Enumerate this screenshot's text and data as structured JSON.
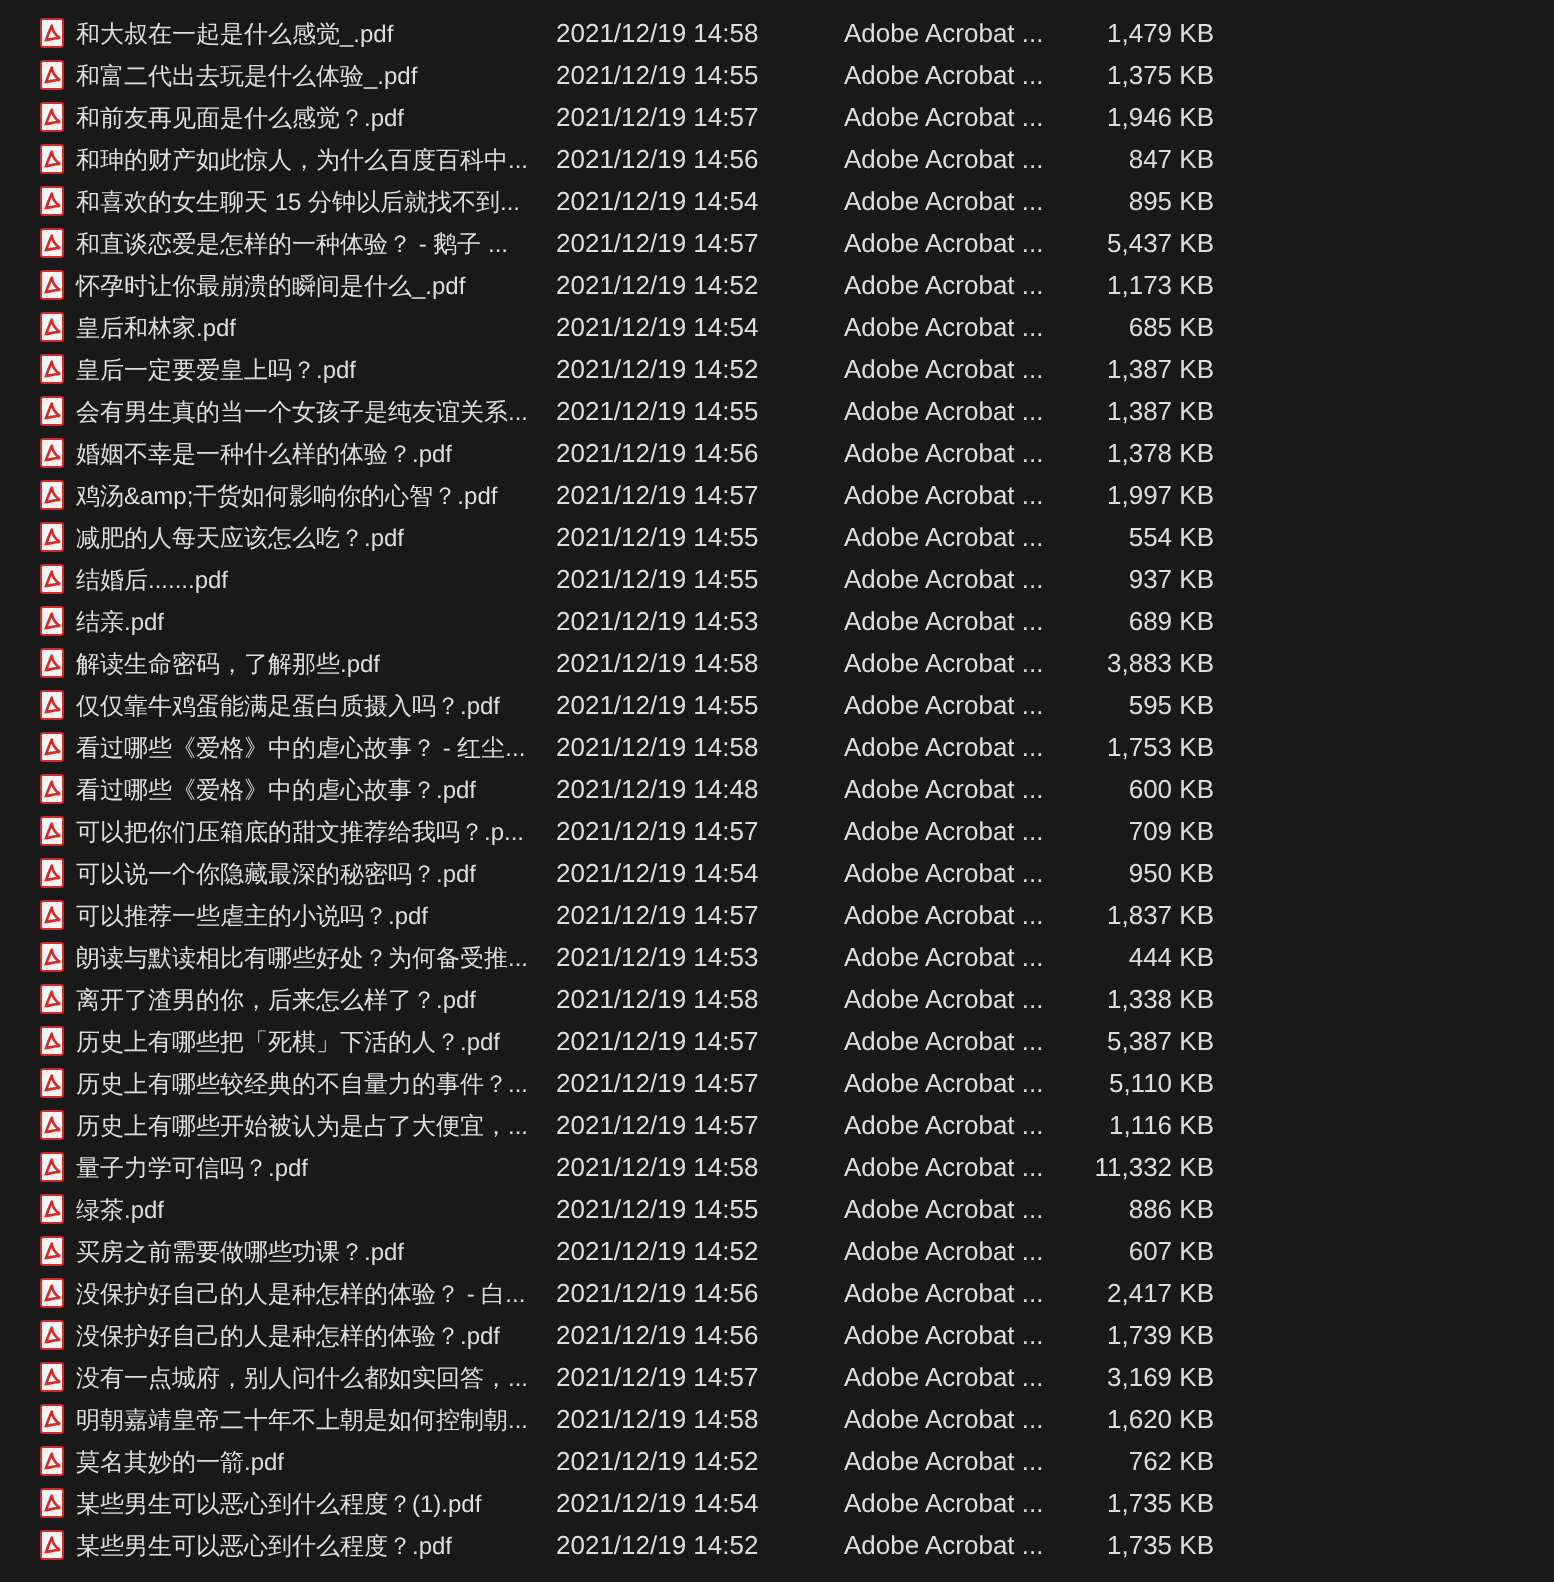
{
  "files": [
    {
      "name": "和大叔在一起是什么感觉_.pdf",
      "modified": "2021/12/19 14:58",
      "type": "Adobe Acrobat ...",
      "size": "1,479 KB"
    },
    {
      "name": "和富二代出去玩是什么体验_.pdf",
      "modified": "2021/12/19 14:55",
      "type": "Adobe Acrobat ...",
      "size": "1,375 KB"
    },
    {
      "name": "和前友再见面是什么感觉？.pdf",
      "modified": "2021/12/19 14:57",
      "type": "Adobe Acrobat ...",
      "size": "1,946 KB"
    },
    {
      "name": "和珅的财产如此惊人，为什么百度百科中...",
      "modified": "2021/12/19 14:56",
      "type": "Adobe Acrobat ...",
      "size": "847 KB"
    },
    {
      "name": "和喜欢的女生聊天 15 分钟以后就找不到...",
      "modified": "2021/12/19 14:54",
      "type": "Adobe Acrobat ...",
      "size": "895 KB"
    },
    {
      "name": "和直谈恋爱是怎样的一种体验？ - 鹅子 ...",
      "modified": "2021/12/19 14:57",
      "type": "Adobe Acrobat ...",
      "size": "5,437 KB"
    },
    {
      "name": "怀孕时让你最崩溃的瞬间是什么_.pdf",
      "modified": "2021/12/19 14:52",
      "type": "Adobe Acrobat ...",
      "size": "1,173 KB"
    },
    {
      "name": "皇后和林家.pdf",
      "modified": "2021/12/19 14:54",
      "type": "Adobe Acrobat ...",
      "size": "685 KB"
    },
    {
      "name": "皇后一定要爱皇上吗？.pdf",
      "modified": "2021/12/19 14:52",
      "type": "Adobe Acrobat ...",
      "size": "1,387 KB"
    },
    {
      "name": "会有男生真的当一个女孩子是纯友谊关系...",
      "modified": "2021/12/19 14:55",
      "type": "Adobe Acrobat ...",
      "size": "1,387 KB"
    },
    {
      "name": "婚姻不幸是一种什么样的体验？.pdf",
      "modified": "2021/12/19 14:56",
      "type": "Adobe Acrobat ...",
      "size": "1,378 KB"
    },
    {
      "name": "鸡汤&amp;干货如何影响你的心智？.pdf",
      "modified": "2021/12/19 14:57",
      "type": "Adobe Acrobat ...",
      "size": "1,997 KB"
    },
    {
      "name": "减肥的人每天应该怎么吃？.pdf",
      "modified": "2021/12/19 14:55",
      "type": "Adobe Acrobat ...",
      "size": "554 KB"
    },
    {
      "name": "结婚后.......pdf",
      "modified": "2021/12/19 14:55",
      "type": "Adobe Acrobat ...",
      "size": "937 KB"
    },
    {
      "name": "结亲.pdf",
      "modified": "2021/12/19 14:53",
      "type": "Adobe Acrobat ...",
      "size": "689 KB"
    },
    {
      "name": "解读生命密码，了解那些.pdf",
      "modified": "2021/12/19 14:58",
      "type": "Adobe Acrobat ...",
      "size": "3,883 KB"
    },
    {
      "name": "仅仅靠牛鸡蛋能满足蛋白质摄入吗？.pdf",
      "modified": "2021/12/19 14:55",
      "type": "Adobe Acrobat ...",
      "size": "595 KB"
    },
    {
      "name": "看过哪些《爱格》中的虐心故事？ - 红尘...",
      "modified": "2021/12/19 14:58",
      "type": "Adobe Acrobat ...",
      "size": "1,753 KB"
    },
    {
      "name": "看过哪些《爱格》中的虐心故事？.pdf",
      "modified": "2021/12/19 14:48",
      "type": "Adobe Acrobat ...",
      "size": "600 KB"
    },
    {
      "name": "可以把你们压箱底的甜文推荐给我吗？.p...",
      "modified": "2021/12/19 14:57",
      "type": "Adobe Acrobat ...",
      "size": "709 KB"
    },
    {
      "name": "可以说一个你隐藏最深的秘密吗？.pdf",
      "modified": "2021/12/19 14:54",
      "type": "Adobe Acrobat ...",
      "size": "950 KB"
    },
    {
      "name": "可以推荐一些虐主的小说吗？.pdf",
      "modified": "2021/12/19 14:57",
      "type": "Adobe Acrobat ...",
      "size": "1,837 KB"
    },
    {
      "name": "朗读与默读相比有哪些好处？为何备受推...",
      "modified": "2021/12/19 14:53",
      "type": "Adobe Acrobat ...",
      "size": "444 KB"
    },
    {
      "name": "离开了渣男的你，后来怎么样了？.pdf",
      "modified": "2021/12/19 14:58",
      "type": "Adobe Acrobat ...",
      "size": "1,338 KB"
    },
    {
      "name": "历史上有哪些把「死棋」下活的人？.pdf",
      "modified": "2021/12/19 14:57",
      "type": "Adobe Acrobat ...",
      "size": "5,387 KB"
    },
    {
      "name": "历史上有哪些较经典的不自量力的事件？...",
      "modified": "2021/12/19 14:57",
      "type": "Adobe Acrobat ...",
      "size": "5,110 KB"
    },
    {
      "name": "历史上有哪些开始被认为是占了大便宜，...",
      "modified": "2021/12/19 14:57",
      "type": "Adobe Acrobat ...",
      "size": "1,116 KB"
    },
    {
      "name": "量子力学可信吗？.pdf",
      "modified": "2021/12/19 14:58",
      "type": "Adobe Acrobat ...",
      "size": "11,332 KB"
    },
    {
      "name": "绿茶.pdf",
      "modified": "2021/12/19 14:55",
      "type": "Adobe Acrobat ...",
      "size": "886 KB"
    },
    {
      "name": "买房之前需要做哪些功课？.pdf",
      "modified": "2021/12/19 14:52",
      "type": "Adobe Acrobat ...",
      "size": "607 KB"
    },
    {
      "name": "没保护好自己的人是种怎样的体验？ - 白...",
      "modified": "2021/12/19 14:56",
      "type": "Adobe Acrobat ...",
      "size": "2,417 KB"
    },
    {
      "name": "没保护好自己的人是种怎样的体验？.pdf",
      "modified": "2021/12/19 14:56",
      "type": "Adobe Acrobat ...",
      "size": "1,739 KB"
    },
    {
      "name": "没有一点城府，别人问什么都如实回答，...",
      "modified": "2021/12/19 14:57",
      "type": "Adobe Acrobat ...",
      "size": "3,169 KB"
    },
    {
      "name": "明朝嘉靖皇帝二十年不上朝是如何控制朝...",
      "modified": "2021/12/19 14:58",
      "type": "Adobe Acrobat ...",
      "size": "1,620 KB"
    },
    {
      "name": "莫名其妙的一箭.pdf",
      "modified": "2021/12/19 14:52",
      "type": "Adobe Acrobat ...",
      "size": "762 KB"
    },
    {
      "name": "某些男生可以恶心到什么程度？(1).pdf",
      "modified": "2021/12/19 14:54",
      "type": "Adobe Acrobat ...",
      "size": "1,735 KB"
    },
    {
      "name": "某些男生可以恶心到什么程度？.pdf",
      "modified": "2021/12/19 14:52",
      "type": "Adobe Acrobat ...",
      "size": "1,735 KB"
    }
  ]
}
